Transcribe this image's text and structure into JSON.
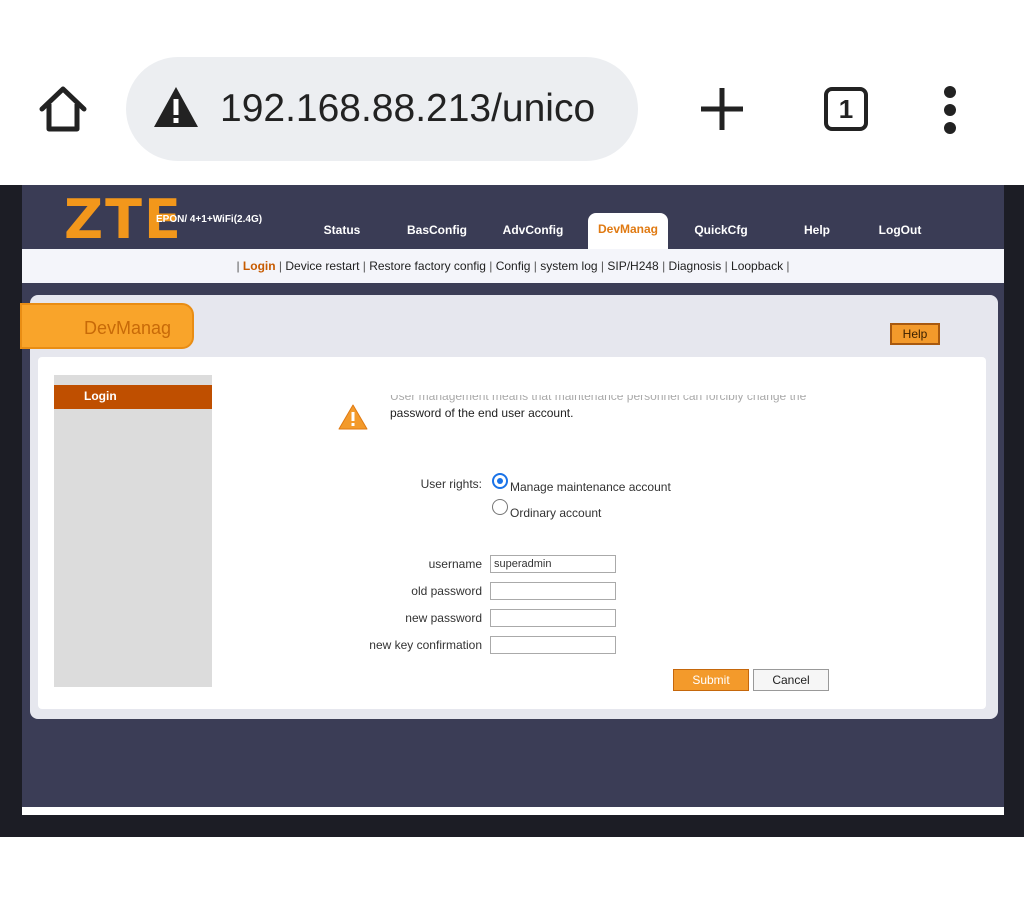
{
  "browser": {
    "url": "192.168.88.213/unico",
    "tab_count": "1"
  },
  "router": {
    "logo": "ZTE",
    "model": "EPON/ 4+1+WiFi(2.4G)",
    "nav": [
      "Status",
      "BasConfig",
      "AdvConfig",
      "DevManag",
      "QuickCfg",
      "Help",
      "LogOut"
    ],
    "active_nav": "DevManag",
    "subnav": [
      "Login",
      "Device restart",
      "Restore factory config",
      "Config",
      "system log",
      "SIP/H248",
      "Diagnosis",
      "Loopback"
    ],
    "page_title": "DevManag",
    "help_label": "Help",
    "side_menu": [
      "Login"
    ],
    "notice_line1": "User management means that maintenance personnel can forcibly change the",
    "notice_line2": "password of the end user account.",
    "user_rights_label": "User rights:",
    "rights_options": [
      "Manage maintenance account",
      "Ordinary account"
    ],
    "selected_right": "Manage maintenance account",
    "username_label": "username",
    "username_value": "superadmin",
    "old_password_label": "old password",
    "new_password_label": "new password",
    "confirm_label": "new key confirmation",
    "submit_label": "Submit",
    "cancel_label": "Cancel"
  },
  "colors": {
    "accent": "#f39a2b",
    "header_bg": "#3a3c55",
    "active_side": "#bf4f00"
  }
}
